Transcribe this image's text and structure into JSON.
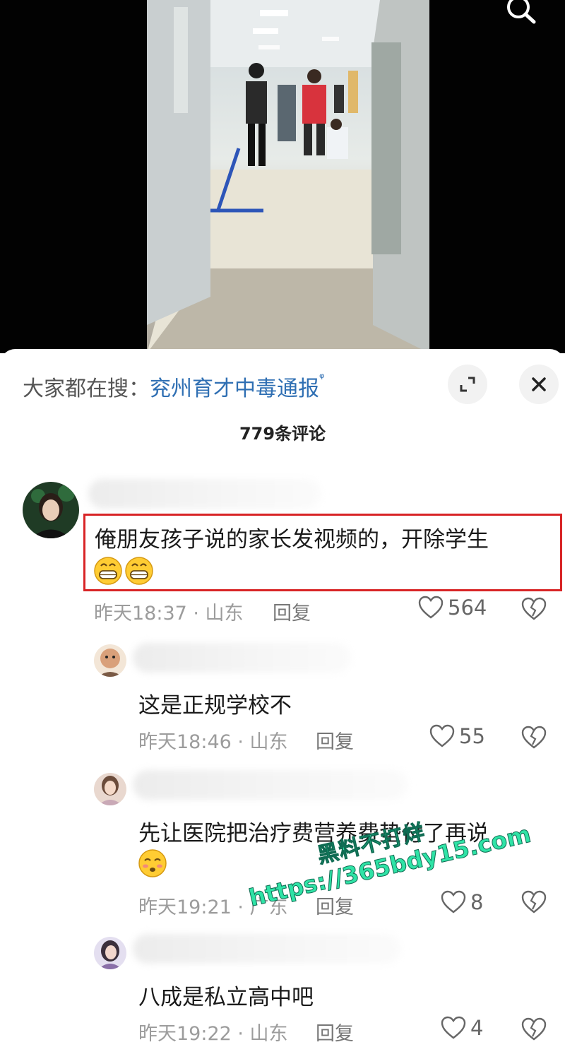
{
  "trending": {
    "prefix": "大家都在搜：",
    "query": "兖州育才中毒通报",
    "search_glyph": "ᵠ"
  },
  "sheet": {
    "comment_count": "779条评论"
  },
  "comments": [
    {
      "text": "俺朋友孩子说的家长发视频的，开除学生",
      "emoji": "grinning-face-with-smiling-eyes ×2",
      "time": "昨天18:37 · 山东",
      "reply": "回复",
      "likes": "564"
    },
    {
      "text": "这是正规学校不",
      "time": "昨天18:46 · 山东",
      "reply": "回复",
      "likes": "55"
    },
    {
      "text": "先让医院把治疗费营养费垫付了再说",
      "emoji": "blushing-face",
      "time": "昨天19:21 · 广东",
      "reply": "回复",
      "likes": "8"
    },
    {
      "text": "八成是私立高中吧",
      "time": "昨天19:22 · 山东",
      "reply": "回复",
      "likes": "4"
    }
  ],
  "watermark": {
    "line1": "黑料不打烊",
    "line2": "https://365bdy15.com"
  },
  "colors": {
    "highlight_border": "#d82426",
    "link": "#2f6fb3",
    "watermark": "#2fe3a6"
  },
  "icons": [
    "search-icon",
    "expand-icon",
    "close-icon",
    "heart-icon",
    "broken-heart-icon"
  ]
}
